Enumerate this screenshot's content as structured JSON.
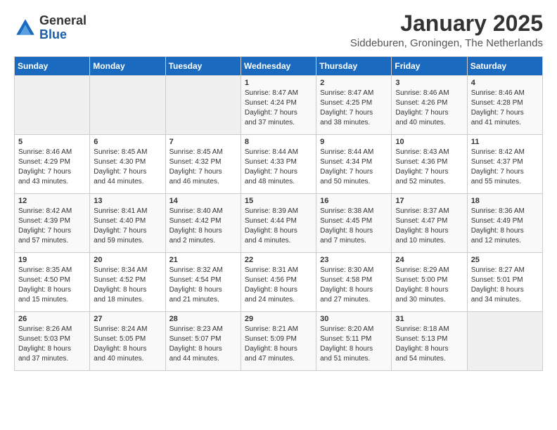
{
  "logo": {
    "general": "General",
    "blue": "Blue"
  },
  "title": "January 2025",
  "location": "Siddeburen, Groningen, The Netherlands",
  "days_header": [
    "Sunday",
    "Monday",
    "Tuesday",
    "Wednesday",
    "Thursday",
    "Friday",
    "Saturday"
  ],
  "weeks": [
    [
      {
        "day": "",
        "info": ""
      },
      {
        "day": "",
        "info": ""
      },
      {
        "day": "",
        "info": ""
      },
      {
        "day": "1",
        "info": "Sunrise: 8:47 AM\nSunset: 4:24 PM\nDaylight: 7 hours\nand 37 minutes."
      },
      {
        "day": "2",
        "info": "Sunrise: 8:47 AM\nSunset: 4:25 PM\nDaylight: 7 hours\nand 38 minutes."
      },
      {
        "day": "3",
        "info": "Sunrise: 8:46 AM\nSunset: 4:26 PM\nDaylight: 7 hours\nand 40 minutes."
      },
      {
        "day": "4",
        "info": "Sunrise: 8:46 AM\nSunset: 4:28 PM\nDaylight: 7 hours\nand 41 minutes."
      }
    ],
    [
      {
        "day": "5",
        "info": "Sunrise: 8:46 AM\nSunset: 4:29 PM\nDaylight: 7 hours\nand 43 minutes."
      },
      {
        "day": "6",
        "info": "Sunrise: 8:45 AM\nSunset: 4:30 PM\nDaylight: 7 hours\nand 44 minutes."
      },
      {
        "day": "7",
        "info": "Sunrise: 8:45 AM\nSunset: 4:32 PM\nDaylight: 7 hours\nand 46 minutes."
      },
      {
        "day": "8",
        "info": "Sunrise: 8:44 AM\nSunset: 4:33 PM\nDaylight: 7 hours\nand 48 minutes."
      },
      {
        "day": "9",
        "info": "Sunrise: 8:44 AM\nSunset: 4:34 PM\nDaylight: 7 hours\nand 50 minutes."
      },
      {
        "day": "10",
        "info": "Sunrise: 8:43 AM\nSunset: 4:36 PM\nDaylight: 7 hours\nand 52 minutes."
      },
      {
        "day": "11",
        "info": "Sunrise: 8:42 AM\nSunset: 4:37 PM\nDaylight: 7 hours\nand 55 minutes."
      }
    ],
    [
      {
        "day": "12",
        "info": "Sunrise: 8:42 AM\nSunset: 4:39 PM\nDaylight: 7 hours\nand 57 minutes."
      },
      {
        "day": "13",
        "info": "Sunrise: 8:41 AM\nSunset: 4:40 PM\nDaylight: 7 hours\nand 59 minutes."
      },
      {
        "day": "14",
        "info": "Sunrise: 8:40 AM\nSunset: 4:42 PM\nDaylight: 8 hours\nand 2 minutes."
      },
      {
        "day": "15",
        "info": "Sunrise: 8:39 AM\nSunset: 4:44 PM\nDaylight: 8 hours\nand 4 minutes."
      },
      {
        "day": "16",
        "info": "Sunrise: 8:38 AM\nSunset: 4:45 PM\nDaylight: 8 hours\nand 7 minutes."
      },
      {
        "day": "17",
        "info": "Sunrise: 8:37 AM\nSunset: 4:47 PM\nDaylight: 8 hours\nand 10 minutes."
      },
      {
        "day": "18",
        "info": "Sunrise: 8:36 AM\nSunset: 4:49 PM\nDaylight: 8 hours\nand 12 minutes."
      }
    ],
    [
      {
        "day": "19",
        "info": "Sunrise: 8:35 AM\nSunset: 4:50 PM\nDaylight: 8 hours\nand 15 minutes."
      },
      {
        "day": "20",
        "info": "Sunrise: 8:34 AM\nSunset: 4:52 PM\nDaylight: 8 hours\nand 18 minutes."
      },
      {
        "day": "21",
        "info": "Sunrise: 8:32 AM\nSunset: 4:54 PM\nDaylight: 8 hours\nand 21 minutes."
      },
      {
        "day": "22",
        "info": "Sunrise: 8:31 AM\nSunset: 4:56 PM\nDaylight: 8 hours\nand 24 minutes."
      },
      {
        "day": "23",
        "info": "Sunrise: 8:30 AM\nSunset: 4:58 PM\nDaylight: 8 hours\nand 27 minutes."
      },
      {
        "day": "24",
        "info": "Sunrise: 8:29 AM\nSunset: 5:00 PM\nDaylight: 8 hours\nand 30 minutes."
      },
      {
        "day": "25",
        "info": "Sunrise: 8:27 AM\nSunset: 5:01 PM\nDaylight: 8 hours\nand 34 minutes."
      }
    ],
    [
      {
        "day": "26",
        "info": "Sunrise: 8:26 AM\nSunset: 5:03 PM\nDaylight: 8 hours\nand 37 minutes."
      },
      {
        "day": "27",
        "info": "Sunrise: 8:24 AM\nSunset: 5:05 PM\nDaylight: 8 hours\nand 40 minutes."
      },
      {
        "day": "28",
        "info": "Sunrise: 8:23 AM\nSunset: 5:07 PM\nDaylight: 8 hours\nand 44 minutes."
      },
      {
        "day": "29",
        "info": "Sunrise: 8:21 AM\nSunset: 5:09 PM\nDaylight: 8 hours\nand 47 minutes."
      },
      {
        "day": "30",
        "info": "Sunrise: 8:20 AM\nSunset: 5:11 PM\nDaylight: 8 hours\nand 51 minutes."
      },
      {
        "day": "31",
        "info": "Sunrise: 8:18 AM\nSunset: 5:13 PM\nDaylight: 8 hours\nand 54 minutes."
      },
      {
        "day": "",
        "info": ""
      }
    ]
  ]
}
